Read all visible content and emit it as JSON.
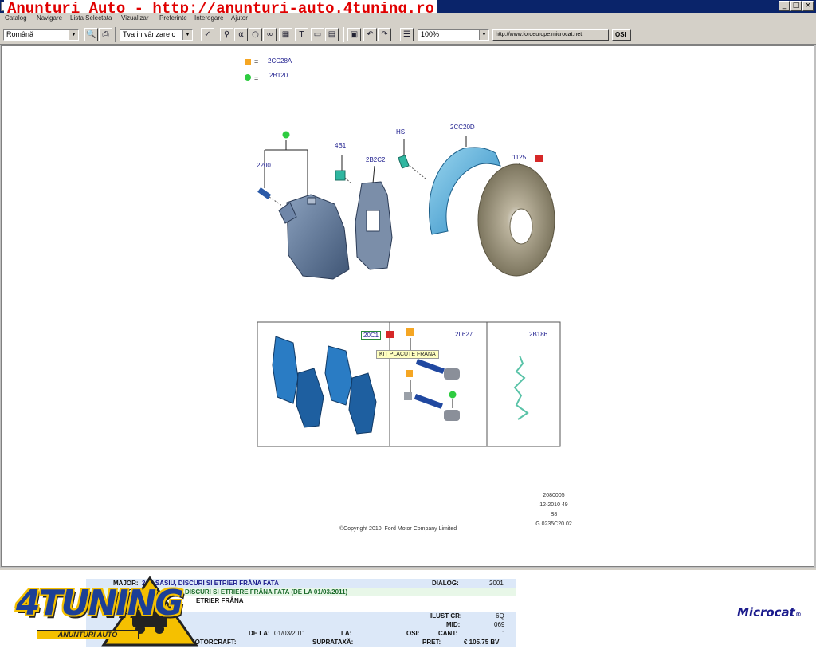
{
  "watermark": "Anunturi Auto - http://anunturi-auto.4tuning.ro",
  "window_buttons": [
    "_",
    "□",
    "×"
  ],
  "menu": [
    "Catalog",
    "Navigare",
    "Lista Selectata",
    "Vizualizar",
    "Preferinte",
    "Interogare",
    "Ajutor"
  ],
  "toolbar": {
    "language": "Română",
    "sale_filter": "Tva in vânzare c",
    "zoom": "100%",
    "url": "http://www.fordeurope.microcat.net",
    "osi_label": "OSI"
  },
  "legend": [
    {
      "color": "#f5a623",
      "code": "2CC28A"
    },
    {
      "color": "#2ecc40",
      "code": "2B120"
    }
  ],
  "parts": {
    "bolt": "2200",
    "bleed": "4B1",
    "carrier": "2B2C2",
    "screw": "HS",
    "shield": "2CC20D",
    "disc": "1125",
    "pads": "20C1",
    "pin_kit": "2L627",
    "spring": "2B186"
  },
  "tooltip": "KIT PLACUTE FRANA",
  "meta_lines": [
    "2080005",
    "12-2010 49",
    "B8",
    "G 0235C20 02"
  ],
  "copyright": "©Copyright 2010, Ford Motor Company Limited",
  "info": {
    "major_label": "MAJOR:",
    "major_value": "20C SASIU, DISCURI SI ETRIER FRÂNA FATA",
    "sect_label": "SECT:",
    "sect_value": "DISCURI SI ETRIERE FRÂNA FATA (DE LA 01/03/2011)",
    "sub_value": "ETRIER FRÂNA",
    "dialog_label": "DIALOG:",
    "dialog_value": "2001",
    "illus_label": "ILUST CR:",
    "illus_value": "6Q",
    "mid_label": "MID:",
    "mid_value": "069",
    "osi_label": "OSI:",
    "cant_label": "CANT:",
    "cant_value": "1",
    "de_la_label": "DE LA:",
    "de_la_value": "01/03/2011",
    "la_label": "LA:",
    "motor_label": "MOTORCRAFT:",
    "suprataxa_label": "SUPRATAXĂ:",
    "pret_label": "PRET:",
    "pret_value": "€ 105.75 BV"
  },
  "logo": {
    "main": "4TUNING",
    "sub": "ANUNTURI AUTO"
  },
  "brand": "Microcat"
}
